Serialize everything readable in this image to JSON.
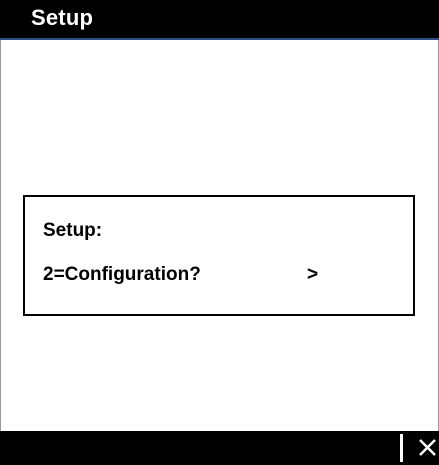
{
  "header": {
    "title": "Setup"
  },
  "dialog": {
    "title": "Setup:",
    "option": "2=Configuration?",
    "arrow": ">"
  },
  "footer": {
    "close_icon": "close-icon"
  },
  "colors": {
    "background": "#ffffff",
    "bars": "#000000",
    "title_text": "#ffffff",
    "accent_line": "#2f4f86",
    "dialog_border": "#000000"
  }
}
